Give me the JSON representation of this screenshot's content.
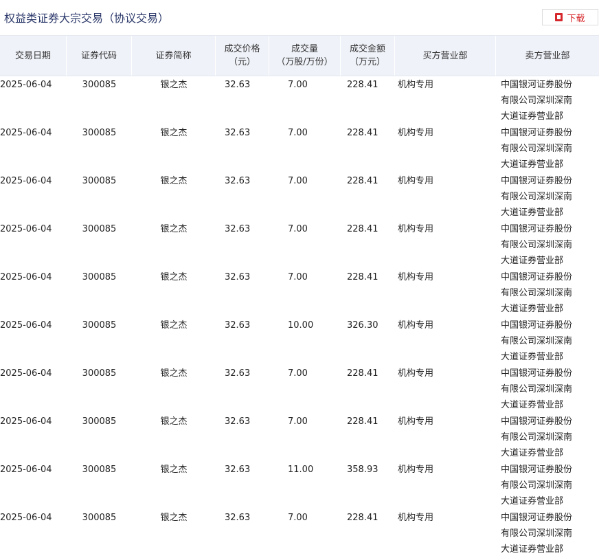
{
  "page": {
    "title": "权益类证券大宗交易（协议交易）",
    "download_label": "下载"
  },
  "table": {
    "headers": {
      "date": "交易日期",
      "code": "证券代码",
      "name": "证券简称",
      "price_l1": "成交价格",
      "price_l2": "（元）",
      "volume_l1": "成交量",
      "volume_l2": "（万股/万份）",
      "amount_l1": "成交金额",
      "amount_l2": "（万元）",
      "buyer": "买方营业部",
      "seller": "卖方营业部"
    },
    "rows": [
      {
        "date": "2025-06-04",
        "code": "300085",
        "name": "银之杰",
        "price": "32.63",
        "volume": "7.00",
        "amount": "228.41",
        "buyer": "机构专用",
        "seller": "中国银河证券股份有限公司深圳深南大道证券营业部"
      },
      {
        "date": "2025-06-04",
        "code": "300085",
        "name": "银之杰",
        "price": "32.63",
        "volume": "7.00",
        "amount": "228.41",
        "buyer": "机构专用",
        "seller": "中国银河证券股份有限公司深圳深南大道证券营业部"
      },
      {
        "date": "2025-06-04",
        "code": "300085",
        "name": "银之杰",
        "price": "32.63",
        "volume": "7.00",
        "amount": "228.41",
        "buyer": "机构专用",
        "seller": "中国银河证券股份有限公司深圳深南大道证券营业部"
      },
      {
        "date": "2025-06-04",
        "code": "300085",
        "name": "银之杰",
        "price": "32.63",
        "volume": "7.00",
        "amount": "228.41",
        "buyer": "机构专用",
        "seller": "中国银河证券股份有限公司深圳深南大道证券营业部"
      },
      {
        "date": "2025-06-04",
        "code": "300085",
        "name": "银之杰",
        "price": "32.63",
        "volume": "7.00",
        "amount": "228.41",
        "buyer": "机构专用",
        "seller": "中国银河证券股份有限公司深圳深南大道证券营业部"
      },
      {
        "date": "2025-06-04",
        "code": "300085",
        "name": "银之杰",
        "price": "32.63",
        "volume": "10.00",
        "amount": "326.30",
        "buyer": "机构专用",
        "seller": "中国银河证券股份有限公司深圳深南大道证券营业部"
      },
      {
        "date": "2025-06-04",
        "code": "300085",
        "name": "银之杰",
        "price": "32.63",
        "volume": "7.00",
        "amount": "228.41",
        "buyer": "机构专用",
        "seller": "中国银河证券股份有限公司深圳深南大道证券营业部"
      },
      {
        "date": "2025-06-04",
        "code": "300085",
        "name": "银之杰",
        "price": "32.63",
        "volume": "7.00",
        "amount": "228.41",
        "buyer": "机构专用",
        "seller": "中国银河证券股份有限公司深圳深南大道证券营业部"
      },
      {
        "date": "2025-06-04",
        "code": "300085",
        "name": "银之杰",
        "price": "32.63",
        "volume": "11.00",
        "amount": "358.93",
        "buyer": "机构专用",
        "seller": "中国银河证券股份有限公司深圳深南大道证券营业部"
      },
      {
        "date": "2025-06-04",
        "code": "300085",
        "name": "银之杰",
        "price": "32.63",
        "volume": "7.00",
        "amount": "228.41",
        "buyer": "机构专用",
        "seller": "中国银河证券股份有限公司深圳深南大道证券营业部"
      }
    ]
  }
}
